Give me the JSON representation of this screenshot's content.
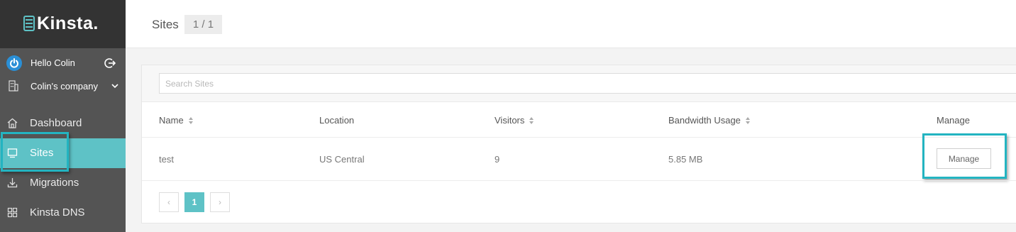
{
  "app": {
    "brand": "Kinsta."
  },
  "user": {
    "greeting": "Hello Colin",
    "company": "Colin's company"
  },
  "sidebar": {
    "items": [
      {
        "label": "Dashboard",
        "icon": "home-icon",
        "active": false
      },
      {
        "label": "Sites",
        "icon": "monitor-icon",
        "active": true
      },
      {
        "label": "Migrations",
        "icon": "download-icon",
        "active": false
      },
      {
        "label": "Kinsta DNS",
        "icon": "grid-icon",
        "active": false
      }
    ]
  },
  "header": {
    "title": "Sites",
    "count": "1 / 1"
  },
  "search": {
    "placeholder": "Search Sites",
    "value": ""
  },
  "table": {
    "columns": [
      "Name",
      "Location",
      "Visitors",
      "Bandwidth Usage",
      "Manage"
    ],
    "rows": [
      {
        "name": "test",
        "location": "US Central",
        "visitors": "9",
        "bandwidth": "5.85 MB",
        "manage_label": "Manage"
      }
    ]
  },
  "pagination": {
    "prev": "‹",
    "current": "1",
    "next": "›"
  },
  "colors": {
    "accent": "#5ec2c6",
    "highlight": "#23b4c1",
    "sidebar": "#545454",
    "logo_bar": "#333333"
  }
}
